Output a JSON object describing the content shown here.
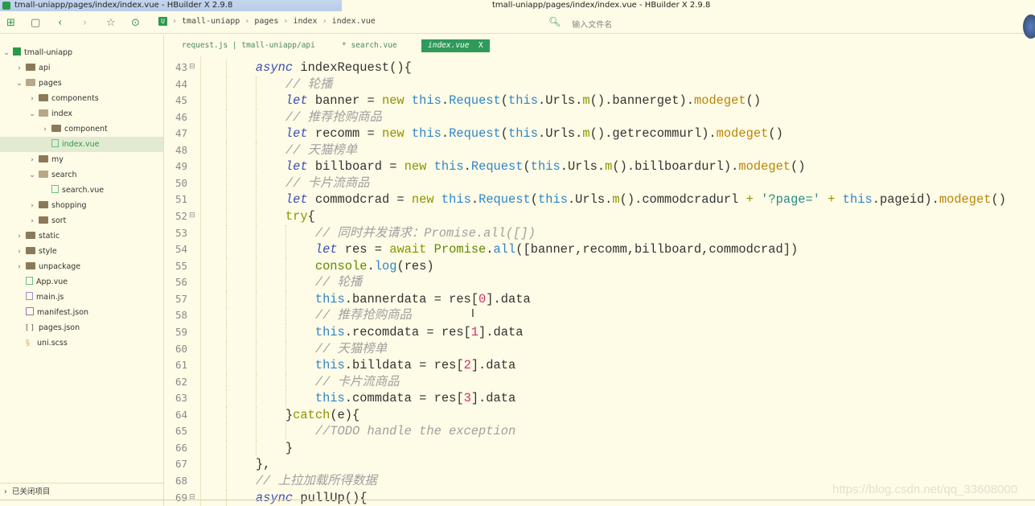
{
  "window": {
    "title": "tmall-uniapp/pages/index/index.vue - HBuilder X 2.9.8"
  },
  "breadcrumb": [
    "tmall-uniapp",
    "pages",
    "index",
    "index.vue"
  ],
  "search": {
    "placeholder": "输入文件名"
  },
  "tree": [
    {
      "label": "tmall-uniapp",
      "level": 0,
      "arrow": "v",
      "icon": "proj"
    },
    {
      "label": "api",
      "level": 1,
      "arrow": ">",
      "icon": "folder"
    },
    {
      "label": "pages",
      "level": 1,
      "arrow": "v",
      "icon": "folder open"
    },
    {
      "label": "components",
      "level": 2,
      "arrow": ">",
      "icon": "folder"
    },
    {
      "label": "index",
      "level": 2,
      "arrow": "v",
      "icon": "folder open"
    },
    {
      "label": "component",
      "level": 3,
      "arrow": ">",
      "icon": "folder"
    },
    {
      "label": "index.vue",
      "level": 3,
      "arrow": "",
      "icon": "vue",
      "selected": true
    },
    {
      "label": "my",
      "level": 2,
      "arrow": ">",
      "icon": "folder"
    },
    {
      "label": "search",
      "level": 2,
      "arrow": "v",
      "icon": "folder open"
    },
    {
      "label": "search.vue",
      "level": 3,
      "arrow": "",
      "icon": "vue"
    },
    {
      "label": "shopping",
      "level": 2,
      "arrow": ">",
      "icon": "folder"
    },
    {
      "label": "sort",
      "level": 2,
      "arrow": ">",
      "icon": "folder"
    },
    {
      "label": "static",
      "level": 1,
      "arrow": ">",
      "icon": "folder"
    },
    {
      "label": "style",
      "level": 1,
      "arrow": ">",
      "icon": "folder"
    },
    {
      "label": "unpackage",
      "level": 1,
      "arrow": ">",
      "icon": "folder"
    },
    {
      "label": "App.vue",
      "level": 1,
      "arrow": "",
      "icon": "vue"
    },
    {
      "label": "main.js",
      "level": 1,
      "arrow": "",
      "icon": "js"
    },
    {
      "label": "manifest.json",
      "level": 1,
      "arrow": "",
      "icon": "json"
    },
    {
      "label": "pages.json",
      "level": 1,
      "arrow": "",
      "icon": "brk"
    },
    {
      "label": "uni.scss",
      "level": 1,
      "arrow": "",
      "icon": "scss"
    }
  ],
  "closed_projects": "已关闭项目",
  "tabs": [
    {
      "label": "request.js | tmall-uniapp/api"
    },
    {
      "label": "* search.vue"
    },
    {
      "label": "index.vue",
      "close": "X",
      "active": true
    }
  ],
  "code": [
    {
      "n": "43",
      "fold": true,
      "ind": 8,
      "t": [
        [
          "kw",
          "async"
        ],
        [
          "p",
          " indexRequest(){"
        ]
      ]
    },
    {
      "n": "44",
      "ind": 12,
      "t": [
        [
          "cm",
          "// 轮播"
        ]
      ]
    },
    {
      "n": "45",
      "ind": 12,
      "t": [
        [
          "kw",
          "let"
        ],
        [
          "p",
          " banner = "
        ],
        [
          "kw2",
          "new"
        ],
        [
          "p",
          " "
        ],
        [
          "fn",
          "this"
        ],
        [
          "p",
          "."
        ],
        [
          "fn",
          "Request"
        ],
        [
          "p",
          "("
        ],
        [
          "fn",
          "this"
        ],
        [
          "p",
          ".Urls."
        ],
        [
          "kw2",
          "m"
        ],
        [
          "p",
          "().bannerget)."
        ],
        [
          "mth",
          "modeget"
        ],
        [
          "p",
          "()"
        ]
      ]
    },
    {
      "n": "46",
      "ind": 12,
      "t": [
        [
          "cm",
          "// 推荐抢购商品"
        ]
      ]
    },
    {
      "n": "47",
      "ind": 12,
      "t": [
        [
          "kw",
          "let"
        ],
        [
          "p",
          " recomm = "
        ],
        [
          "kw2",
          "new"
        ],
        [
          "p",
          " "
        ],
        [
          "fn",
          "this"
        ],
        [
          "p",
          "."
        ],
        [
          "fn",
          "Request"
        ],
        [
          "p",
          "("
        ],
        [
          "fn",
          "this"
        ],
        [
          "p",
          ".Urls."
        ],
        [
          "kw2",
          "m"
        ],
        [
          "p",
          "().getrecommurl)."
        ],
        [
          "mth",
          "modeget"
        ],
        [
          "p",
          "()"
        ]
      ]
    },
    {
      "n": "48",
      "ind": 12,
      "t": [
        [
          "cm",
          "// 天猫榜单"
        ]
      ]
    },
    {
      "n": "49",
      "ind": 12,
      "t": [
        [
          "kw",
          "let"
        ],
        [
          "p",
          " billboard = "
        ],
        [
          "kw2",
          "new"
        ],
        [
          "p",
          " "
        ],
        [
          "fn",
          "this"
        ],
        [
          "p",
          "."
        ],
        [
          "fn",
          "Request"
        ],
        [
          "p",
          "("
        ],
        [
          "fn",
          "this"
        ],
        [
          "p",
          ".Urls."
        ],
        [
          "kw2",
          "m"
        ],
        [
          "p",
          "().billboardurl)."
        ],
        [
          "mth",
          "modeget"
        ],
        [
          "p",
          "()"
        ]
      ]
    },
    {
      "n": "50",
      "ind": 12,
      "t": [
        [
          "cm",
          "// 卡片流商品"
        ]
      ]
    },
    {
      "n": "51",
      "ind": 12,
      "t": [
        [
          "kw",
          "let"
        ],
        [
          "p",
          " commodcrad = "
        ],
        [
          "kw2",
          "new"
        ],
        [
          "p",
          " "
        ],
        [
          "fn",
          "this"
        ],
        [
          "p",
          "."
        ],
        [
          "fn",
          "Request"
        ],
        [
          "p",
          "("
        ],
        [
          "fn",
          "this"
        ],
        [
          "p",
          ".Urls."
        ],
        [
          "kw2",
          "m"
        ],
        [
          "p",
          "().commodcradurl "
        ],
        [
          "kw2",
          "+"
        ],
        [
          "p",
          " "
        ],
        [
          "str",
          "'?page='"
        ],
        [
          "p",
          " "
        ],
        [
          "kw2",
          "+"
        ],
        [
          "p",
          " "
        ],
        [
          "fn",
          "this"
        ],
        [
          "p",
          ".pageid)."
        ],
        [
          "mth",
          "modeget"
        ],
        [
          "p",
          "()"
        ]
      ]
    },
    {
      "n": "52",
      "fold": true,
      "ind": 12,
      "t": [
        [
          "kw2",
          "try"
        ],
        [
          "p",
          "{"
        ]
      ]
    },
    {
      "n": "53",
      "ind": 16,
      "t": [
        [
          "cm",
          "// 同时并发请求：Promise.all([])"
        ]
      ]
    },
    {
      "n": "54",
      "ind": 16,
      "t": [
        [
          "kw",
          "let"
        ],
        [
          "p",
          " res = "
        ],
        [
          "kw2",
          "await"
        ],
        [
          "p",
          " "
        ],
        [
          "cls",
          "Promise"
        ],
        [
          "p",
          "."
        ],
        [
          "fn",
          "all"
        ],
        [
          "p",
          "([banner,recomm,billboard,commodcrad])"
        ]
      ]
    },
    {
      "n": "55",
      "ind": 16,
      "t": [
        [
          "cls",
          "console"
        ],
        [
          "p",
          "."
        ],
        [
          "fn",
          "log"
        ],
        [
          "p",
          "(res)"
        ]
      ]
    },
    {
      "n": "56",
      "ind": 16,
      "t": [
        [
          "cm",
          "// 轮播"
        ]
      ]
    },
    {
      "n": "57",
      "ind": 16,
      "t": [
        [
          "fn",
          "this"
        ],
        [
          "p",
          ".bannerdata = res["
        ],
        [
          "num",
          "0"
        ],
        [
          "p",
          "].data"
        ]
      ]
    },
    {
      "n": "58",
      "ind": 16,
      "t": [
        [
          "cm",
          "// 推荐抢购商品"
        ]
      ]
    },
    {
      "n": "59",
      "ind": 16,
      "t": [
        [
          "fn",
          "this"
        ],
        [
          "p",
          ".recomdata = res["
        ],
        [
          "num",
          "1"
        ],
        [
          "p",
          "].data"
        ]
      ]
    },
    {
      "n": "60",
      "ind": 16,
      "t": [
        [
          "cm",
          "// 天猫榜单"
        ]
      ]
    },
    {
      "n": "61",
      "ind": 16,
      "t": [
        [
          "fn",
          "this"
        ],
        [
          "p",
          ".billdata = res["
        ],
        [
          "num",
          "2"
        ],
        [
          "p",
          "].data"
        ]
      ]
    },
    {
      "n": "62",
      "ind": 16,
      "t": [
        [
          "cm",
          "// 卡片流商品"
        ]
      ]
    },
    {
      "n": "63",
      "ind": 16,
      "t": [
        [
          "fn",
          "this"
        ],
        [
          "p",
          ".commdata = res["
        ],
        [
          "num",
          "3"
        ],
        [
          "p",
          "].data"
        ]
      ]
    },
    {
      "n": "64",
      "ind": 12,
      "t": [
        [
          "p",
          "}"
        ],
        [
          "kw2",
          "catch"
        ],
        [
          "p",
          "(e){"
        ]
      ]
    },
    {
      "n": "65",
      "ind": 16,
      "t": [
        [
          "cm",
          "//TODO handle the exception"
        ]
      ]
    },
    {
      "n": "66",
      "ind": 12,
      "t": [
        [
          "p",
          "}"
        ]
      ]
    },
    {
      "n": "67",
      "ind": 8,
      "t": [
        [
          "p",
          "},"
        ]
      ]
    },
    {
      "n": "68",
      "ind": 8,
      "t": [
        [
          "cm",
          "// 上拉加载所得数据"
        ]
      ]
    },
    {
      "n": "69",
      "fold": true,
      "ind": 8,
      "t": [
        [
          "kw",
          "async"
        ],
        [
          "p",
          " pullUp(){"
        ]
      ]
    }
  ],
  "watermark": "https://blog.csdn.net/qq_33608000",
  "colors": {
    "accent": "#2f9a5a",
    "background": "#fefbe6",
    "keyword": "#3d4fb5",
    "this": "#2f86c8",
    "comment": "#a0a0a0",
    "number": "#d0306f"
  }
}
